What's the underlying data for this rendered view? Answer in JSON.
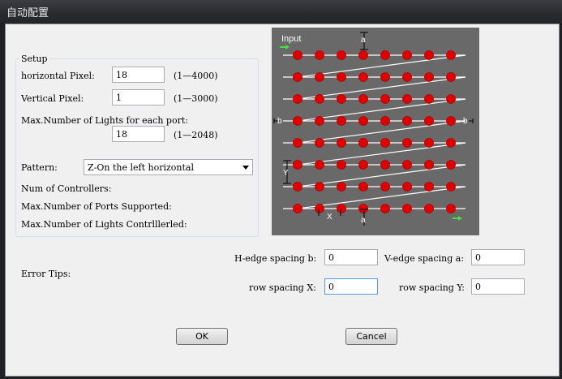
{
  "window": {
    "title": "自动配置"
  },
  "setup": {
    "group_label": "Setup",
    "horizontal_pixel": {
      "label": "horizontal Pixel:",
      "value": "18",
      "range": "(1—4000)"
    },
    "vertical_pixel": {
      "label": "Vertical Pixel:",
      "value": "1",
      "range": "(1—3000)"
    },
    "max_lights": {
      "label": "Max.Number of Lights for each port:",
      "value": "18",
      "range": "(1—2048)"
    },
    "pattern": {
      "label": "Pattern:",
      "value": "Z-On the left horizontal"
    },
    "num_controllers": "Num of Controllers:",
    "max_ports": "Max.Number of Ports Supported:",
    "max_lights_controlled": "Max.Number of Lights Contrlllerled:"
  },
  "error_tips": "Error Tips:",
  "spacing": {
    "h_edge": {
      "label": "H-edge spacing b:",
      "value": "0"
    },
    "v_edge": {
      "label": "V-edge spacing a:",
      "value": "0"
    },
    "row_x": {
      "label": "row spacing X:",
      "value": "0"
    },
    "row_y": {
      "label": "row spacing Y:",
      "value": "0"
    }
  },
  "buttons": {
    "ok": "OK",
    "cancel": "Cancel"
  },
  "diagram": {
    "input_label": "Input",
    "label_a": "a",
    "label_b": "b",
    "label_x": "X",
    "label_y": "Y",
    "rows": 8,
    "cols": 8,
    "background": "#696969",
    "led_color": "#e00000"
  }
}
